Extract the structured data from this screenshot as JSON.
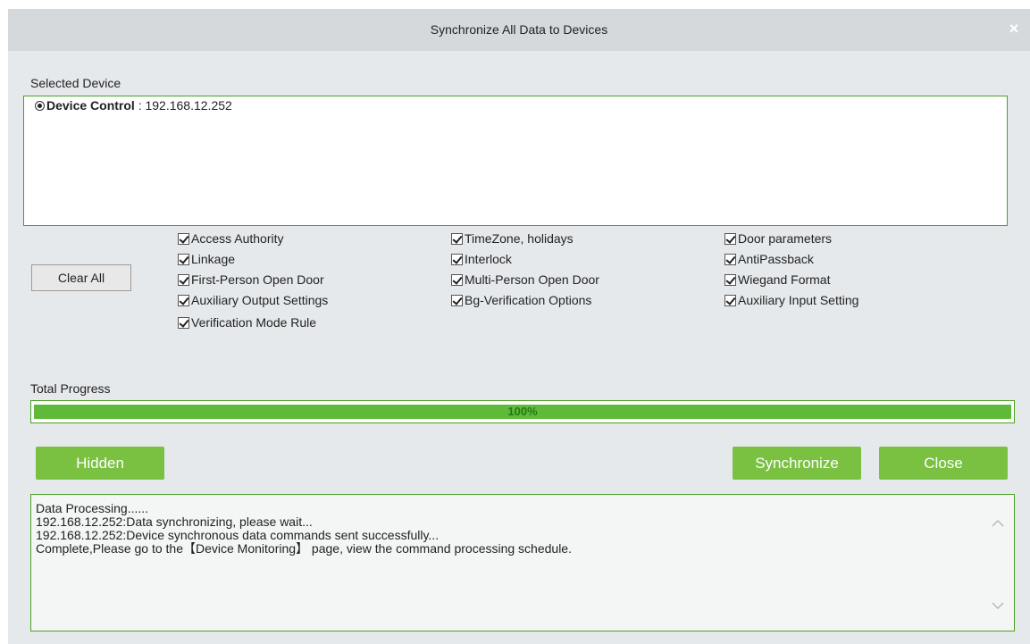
{
  "window": {
    "title": "Synchronize All Data to Devices",
    "close_glyph": "×"
  },
  "device_section": {
    "label": "Selected Device",
    "device": {
      "name": "Device Control",
      "separator": " : ",
      "ip": "192.168.12.252",
      "selected": true
    }
  },
  "clear_button": "Clear All",
  "options": [
    {
      "label": "Access Authority",
      "checked": true
    },
    {
      "label": "TimeZone, holidays",
      "checked": true
    },
    {
      "label": "Door parameters",
      "checked": true
    },
    {
      "label": "Linkage",
      "checked": true
    },
    {
      "label": "Interlock",
      "checked": true
    },
    {
      "label": "AntiPassback",
      "checked": true
    },
    {
      "label": "First-Person Open Door",
      "checked": true
    },
    {
      "label": "Multi-Person Open Door",
      "checked": true
    },
    {
      "label": "Wiegand Format",
      "checked": true
    },
    {
      "label": "Auxiliary Output Settings",
      "checked": true
    },
    {
      "label": "Bg-Verification Options",
      "checked": true
    },
    {
      "label": "Auxiliary Input Setting",
      "checked": true
    },
    {
      "label": "Verification Mode Rule",
      "checked": true
    }
  ],
  "progress": {
    "label": "Total Progress",
    "value": 1.0,
    "text": "100%",
    "color": "#5fba3a"
  },
  "buttons": {
    "hidden": "Hidden",
    "synchronize": "Synchronize",
    "close": "Close"
  },
  "log": [
    "Data Processing......",
    "192.168.12.252:Data synchronizing, please wait...",
    "192.168.12.252:Device synchronous data commands sent successfully...",
    "Complete,Please go to the【Device Monitoring】 page, view the command processing schedule."
  ],
  "colors": {
    "accent_green": "#7ac142",
    "border_green": "#4aa024"
  },
  "icons": {
    "close": "close-icon",
    "scroll_up": "chevron-up-icon",
    "scroll_down": "chevron-down-icon"
  }
}
